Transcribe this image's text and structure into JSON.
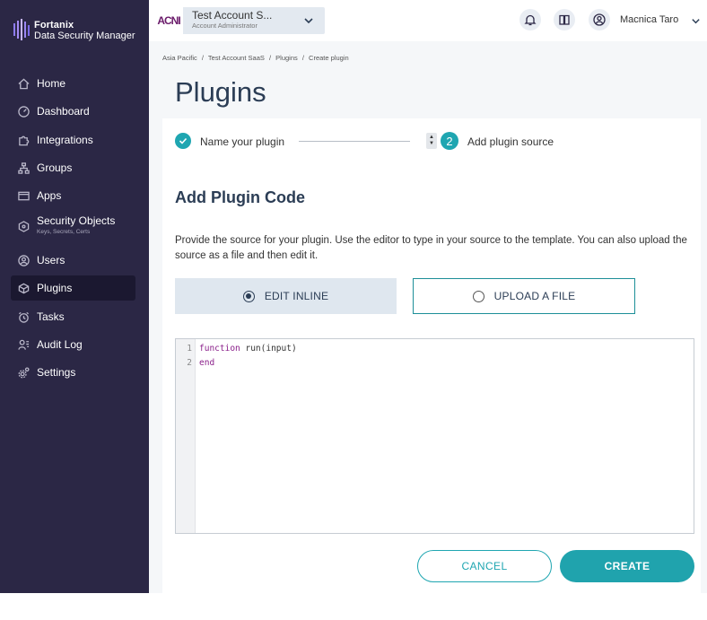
{
  "brand": {
    "name": "Fortanix",
    "product": "Data Security Manager"
  },
  "sidebar": {
    "items": [
      {
        "label": "Home",
        "icon": "home-icon"
      },
      {
        "label": "Dashboard",
        "icon": "dashboard-icon"
      },
      {
        "label": "Integrations",
        "icon": "puzzle-icon"
      },
      {
        "label": "Groups",
        "icon": "groups-icon"
      },
      {
        "label": "Apps",
        "icon": "apps-icon"
      },
      {
        "label": "Security Objects",
        "sub": "Keys, Secrets, Certs",
        "icon": "security-objects-icon"
      },
      {
        "label": "Users",
        "icon": "user-icon"
      },
      {
        "label": "Plugins",
        "icon": "plugin-icon",
        "active": true
      },
      {
        "label": "Tasks",
        "icon": "alarm-icon"
      },
      {
        "label": "Audit Log",
        "icon": "audit-log-icon"
      },
      {
        "label": "Settings",
        "icon": "gear-icon"
      }
    ]
  },
  "header": {
    "account_logo": "ACNI",
    "account_name": "Test Account S...",
    "account_role": "Account Administrator",
    "user_name": "Macnica Taro"
  },
  "breadcrumb": [
    "Asia Pacific",
    "/",
    "Test Account SaaS",
    "/",
    "Plugins",
    "/",
    "Create plugin"
  ],
  "page": {
    "title": "Plugins"
  },
  "steps": {
    "step1": "Name your plugin",
    "step2_number": "2",
    "step2": "Add plugin source"
  },
  "section": {
    "title": "Add Plugin Code",
    "description": "Provide the source for your plugin. Use the editor to type in your source to the template. You can also upload the source as a file and then edit it."
  },
  "options": {
    "inline": "EDIT INLINE",
    "upload": "UPLOAD A FILE",
    "selected": "inline"
  },
  "editor": {
    "lines": [
      {
        "num": "1",
        "keyword": "function",
        "rest": " run(input)"
      },
      {
        "num": "2",
        "keyword": "end",
        "rest": ""
      }
    ]
  },
  "actions": {
    "cancel": "CANCEL",
    "create": "CREATE"
  },
  "colors": {
    "sidebar": "#2b2745",
    "accent": "#1fa6b1",
    "title": "#2b3d55"
  }
}
